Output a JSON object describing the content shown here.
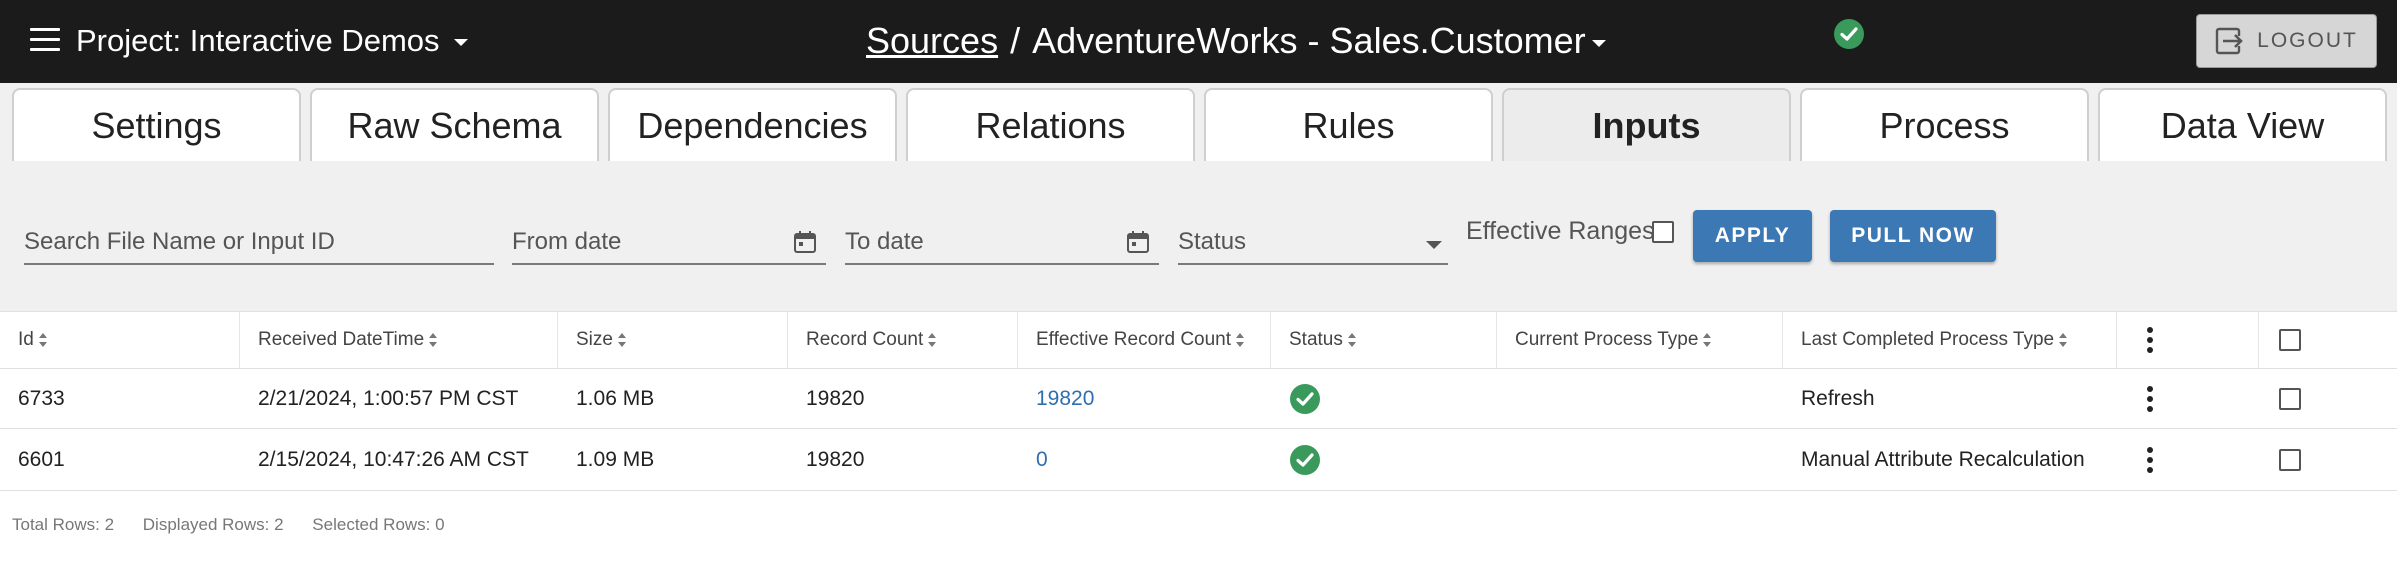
{
  "header": {
    "project_prefix": "Project:",
    "project_name": "Interactive Demos",
    "breadcrumb_link": "Sources",
    "breadcrumb_sep": "/",
    "dataset_name": "AdventureWorks - Sales.Customer",
    "logout_label": "LOGOUT",
    "status_color": "#3a9a5c"
  },
  "tabs": [
    {
      "label": "Settings"
    },
    {
      "label": "Raw Schema"
    },
    {
      "label": "Dependencies"
    },
    {
      "label": "Relations"
    },
    {
      "label": "Rules"
    },
    {
      "label": "Inputs"
    },
    {
      "label": "Process"
    },
    {
      "label": "Data View"
    }
  ],
  "active_tab": "Inputs",
  "filters": {
    "search_placeholder": "Search File Name or Input ID",
    "from_placeholder": "From date",
    "to_placeholder": "To date",
    "status_placeholder": "Status",
    "effective_ranges_label": "Effective Ranges",
    "apply_label": "APPLY",
    "pull_label": "PULL NOW",
    "accent": "#3c78b4"
  },
  "table": {
    "columns": [
      "Id",
      "Received DateTime",
      "Size",
      "Record Count",
      "Effective Record Count",
      "Status",
      "Current Process Type",
      "Last Completed Process Type"
    ],
    "rows": [
      {
        "id": "6733",
        "received": "2/21/2024, 1:00:57 PM CST",
        "size": "1.06 MB",
        "records": "19820",
        "effective": "19820",
        "current": "",
        "last": "Refresh"
      },
      {
        "id": "6601",
        "received": "2/15/2024, 10:47:26 AM CST",
        "size": "1.09 MB",
        "records": "19820",
        "effective": "0",
        "current": "",
        "last": "Manual Attribute Recalculation"
      }
    ]
  },
  "footer": {
    "total": "Total Rows: 2",
    "displayed": "Displayed Rows: 2",
    "selected": "Selected Rows: 0"
  }
}
